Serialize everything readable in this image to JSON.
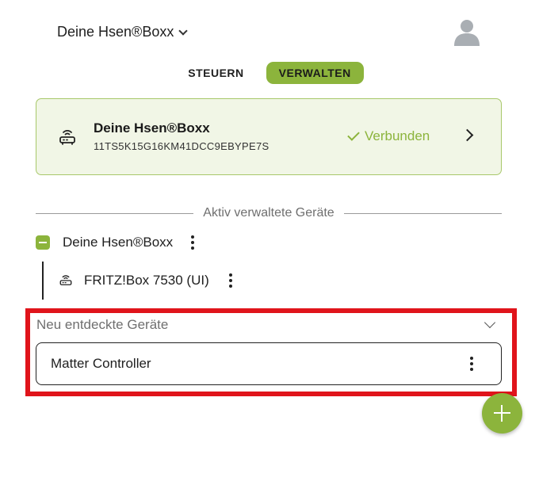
{
  "header": {
    "title": "Deine Hsen®Boxx",
    "dropdown_icon": "chevron-down-icon",
    "avatar_icon": "user-avatar-icon"
  },
  "tabs": [
    {
      "label": "STEUERN",
      "active": false
    },
    {
      "label": "VERWALTEN",
      "active": true
    }
  ],
  "box": {
    "icon": "router-icon",
    "name": "Deine Hsen®Boxx",
    "serial": "11TS5K15G16KM41DCC9EBYPE7S",
    "status": "Verbunden",
    "status_icon": "check-icon",
    "arrow_icon": "chevron-right-icon"
  },
  "managed": {
    "section_title": "Aktiv verwaltete Geräte",
    "parent": {
      "name": "Deine Hsen®Boxx"
    },
    "children": [
      {
        "name": "FRITZ!Box 7530 (UI)",
        "icon": "router-icon"
      }
    ]
  },
  "discovered": {
    "section_title": "Neu entdeckte Geräte",
    "items": [
      {
        "name": "Matter Controller"
      }
    ]
  },
  "colors": {
    "accent": "#8cb43c",
    "card_bg": "#f1f6e6",
    "highlight": "#e0141b"
  }
}
